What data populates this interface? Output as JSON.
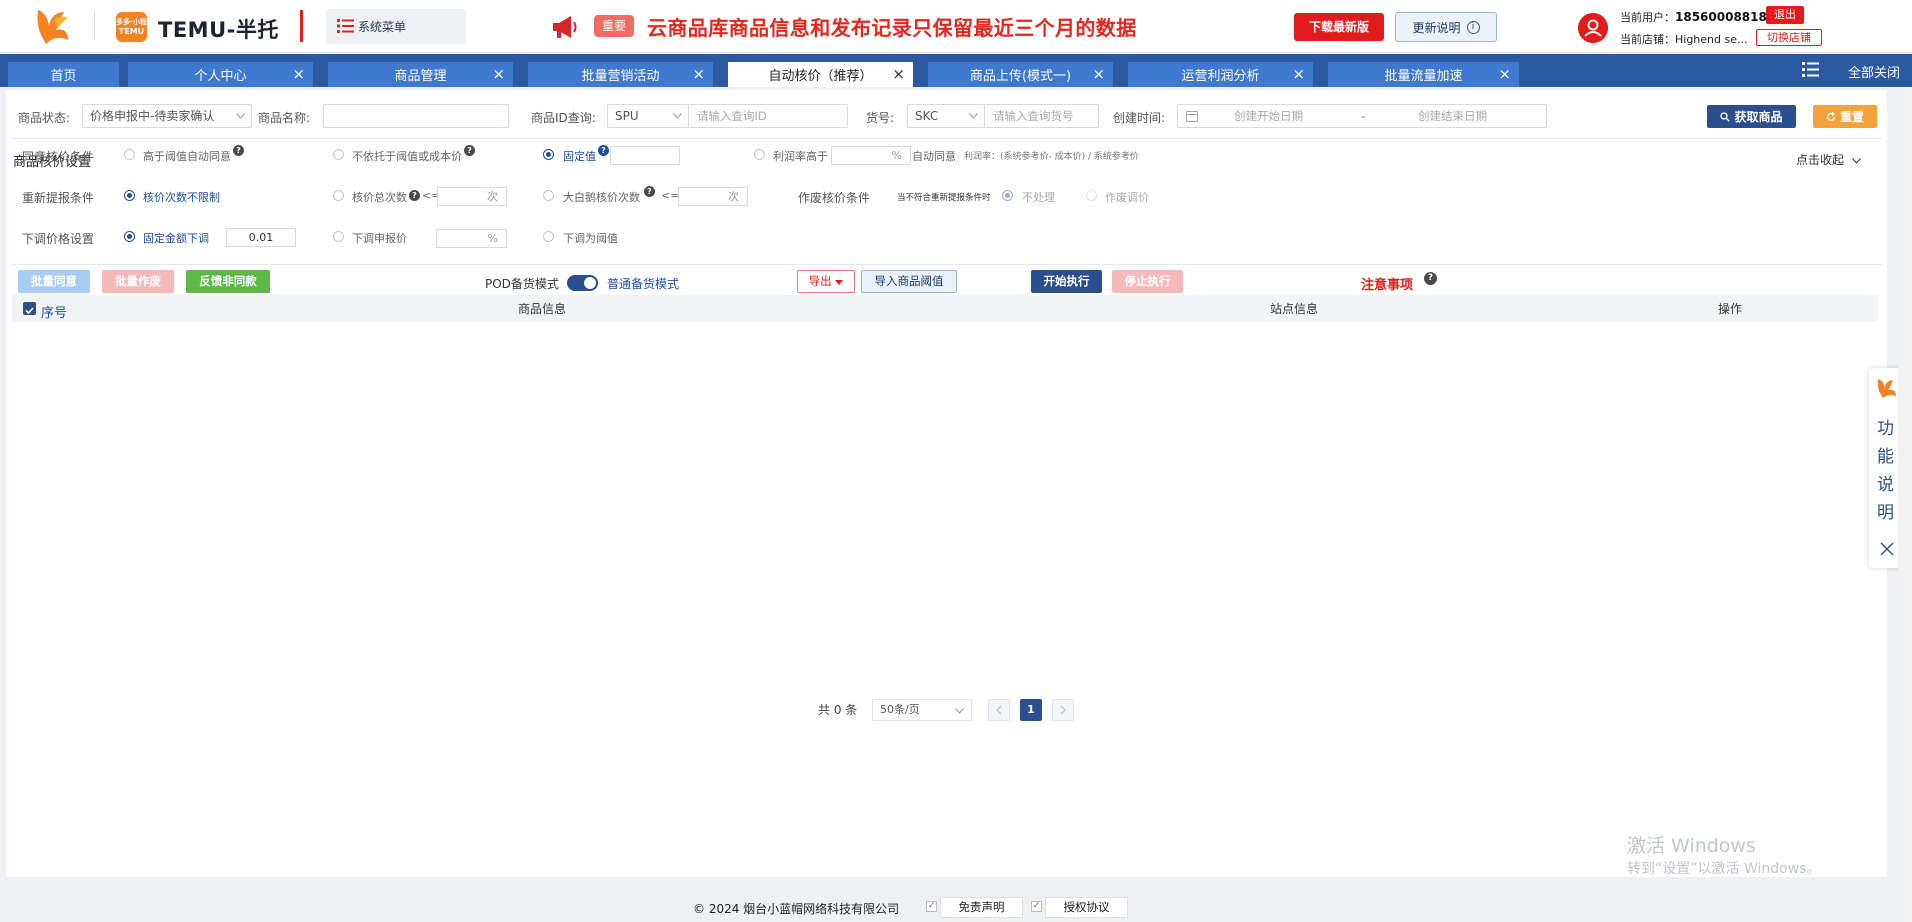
{
  "header": {
    "temu_badge_top": "多多·小程",
    "temu_badge_bottom": "TEMU",
    "brand": "TEMU-半托",
    "system_menu": "系统菜单",
    "important_badge": "重要",
    "notice": "云商品库商品信息和发布记录只保留最近三个月的数据",
    "download_btn": "下载最新版",
    "update_notes_btn": "更新说明",
    "current_user_label": "当前用户：",
    "current_user_value": "18560008818",
    "logout_btn": "退出",
    "current_store_label": "当前店铺：",
    "current_store_value": "Highend se...",
    "switch_store_btn": "切换店铺"
  },
  "tabs": [
    {
      "label": "首页",
      "closable": false
    },
    {
      "label": "个人中心",
      "closable": true
    },
    {
      "label": "商品管理",
      "closable": true
    },
    {
      "label": "批量营销活动",
      "closable": true
    },
    {
      "label": "自动核价（推荐）",
      "closable": true,
      "active": true
    },
    {
      "label": "商品上传(模式一)",
      "closable": true
    },
    {
      "label": "运营利润分析",
      "closable": true
    },
    {
      "label": "批量流量加速",
      "closable": true
    }
  ],
  "tab_close_glyph": "×",
  "close_all": "全部关闭",
  "filters": {
    "status_label": "商品状态:",
    "status_value": "价格申报中-待卖家确认",
    "name_label": "商品名称:",
    "id_label": "商品ID查询:",
    "id_type": "SPU",
    "id_placeholder": "请输入查询ID",
    "sku_label": "货号:",
    "sku_type": "SKC",
    "sku_placeholder": "请输入查询货号",
    "created_label": "创建时间:",
    "start_placeholder": "创建开始日期",
    "range_sep": "-",
    "end_placeholder": "创建结束日期",
    "fetch_btn": "获取商品",
    "reset_btn": "重置"
  },
  "settings": {
    "title": "商品核价设置",
    "collapse": "点击收起",
    "agree_label": "同意核价条件",
    "agree_opt1": "高于阈值自动同意",
    "agree_opt2": "不依托于阈值或成本价",
    "agree_opt3": "固定值",
    "agree_opt4": "利润率高于",
    "percent": "%",
    "auto_agree": "自动同意",
    "profit_formula": "利润率：(系统参考价- 成本价) / 系统参考价",
    "resubmit_label": "重新提报条件",
    "resubmit_opt1": "核价次数不限制",
    "resubmit_opt2": "核价总次数",
    "le": "<=",
    "times": "次",
    "resubmit_opt3": "大白鹅核价次数",
    "void_label": "作废核价条件",
    "void_cond": "当不符合重新提报条件时",
    "void_opt1": "不处理",
    "void_opt2": "作废调价",
    "down_label": "下调价格设置",
    "down_opt1": "固定金额下调",
    "down_value": "0.01",
    "down_opt2": "下调申报价",
    "down_opt3": "下调为阈值",
    "help_glyph": "?"
  },
  "actions": {
    "batch_agree": "批量同意",
    "batch_void": "批量作废",
    "feedback": "反馈非同款",
    "pod_mode": "POD备货模式",
    "normal_mode": "普通备货模式",
    "export": "导出",
    "import_threshold": "导入商品阈值",
    "start": "开始执行",
    "stop": "停止执行",
    "notes": "注意事项"
  },
  "table": {
    "col_index": "序号",
    "col_product": "商品信息",
    "col_site": "站点信息",
    "col_ops": "操作"
  },
  "pagination": {
    "total": "共 0 条",
    "page_size": "50条/页",
    "current_page": "1"
  },
  "side_widget": {
    "chars": [
      "功",
      "能",
      "说",
      "明"
    ]
  },
  "watermark": {
    "line1": "激活 Windows",
    "line2": "转到“设置”以激活 Windows。"
  },
  "footer": {
    "copyright": "© 2024 烟台小蓝帽网络科技有限公司",
    "disclaimer": "免责声明",
    "license": "授权协议",
    "check_glyph": "✓"
  },
  "colors": {
    "brand_red": "#e21c1c",
    "navy": "#2b4f8c",
    "tab_blue": "#3f78cf",
    "tabbar": "#2b5aa3",
    "orange": "#f3a33b"
  }
}
